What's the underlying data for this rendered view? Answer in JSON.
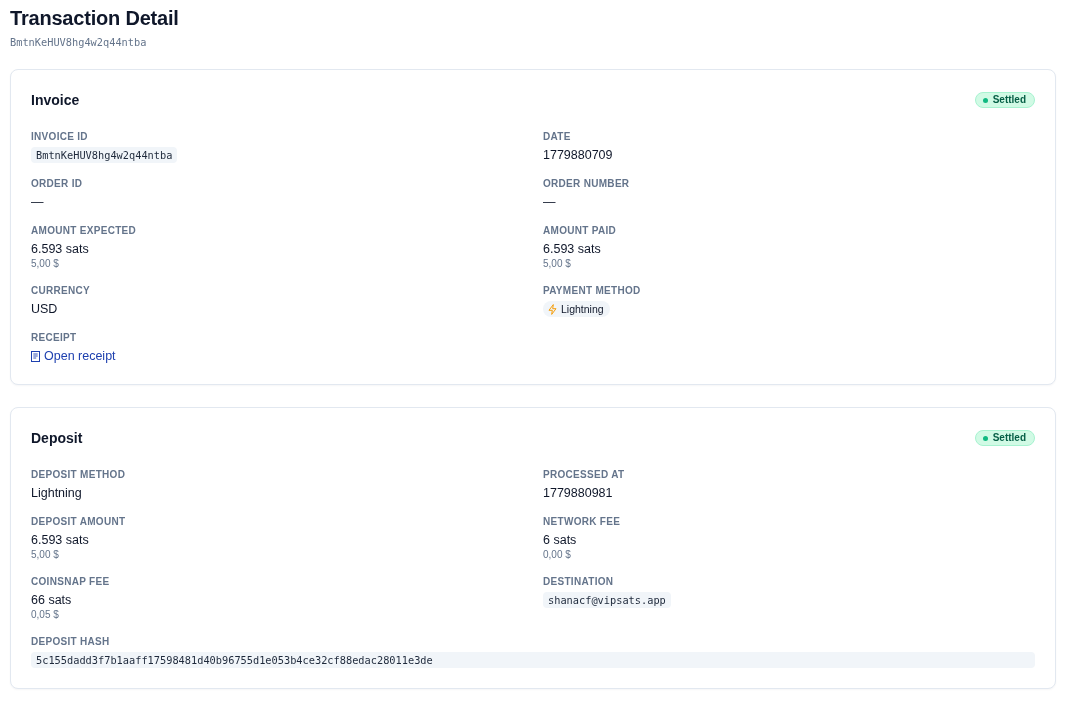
{
  "page": {
    "title": "Transaction Detail",
    "subtitle": "BmtnKeHUV8hg4w2q44ntba"
  },
  "sections": [
    {
      "title": "Invoice",
      "status": {
        "label": "Settled"
      },
      "fields": [
        {
          "label": "INVOICE ID",
          "kind": "code",
          "value": "BmtnKeHUV8hg4w2q44ntba"
        },
        {
          "label": "DATE",
          "kind": "text",
          "value": "1779880709"
        },
        {
          "label": "ORDER ID",
          "kind": "text",
          "value": "—"
        },
        {
          "label": "ORDER NUMBER",
          "kind": "text",
          "value": "—"
        },
        {
          "label": "AMOUNT EXPECTED",
          "kind": "amount",
          "value": "6.593 sats",
          "fiat": "5,00 $"
        },
        {
          "label": "AMOUNT PAID",
          "kind": "amount",
          "value": "6.593 sats",
          "fiat": "5,00 $"
        },
        {
          "label": "CURRENCY",
          "kind": "text",
          "value": "USD"
        },
        {
          "label": "PAYMENT METHOD",
          "kind": "method",
          "value": "Lightning"
        },
        {
          "label": "RECEIPT",
          "kind": "link",
          "value": "Open receipt"
        }
      ]
    },
    {
      "title": "Deposit",
      "status": {
        "label": "Settled"
      },
      "fields": [
        {
          "label": "DEPOSIT METHOD",
          "kind": "text",
          "value": "Lightning"
        },
        {
          "label": "PROCESSED AT",
          "kind": "text",
          "value": "1779880981"
        },
        {
          "label": "DEPOSIT AMOUNT",
          "kind": "amount",
          "value": "6.593 sats",
          "fiat": "5,00 $"
        },
        {
          "label": "NETWORK FEE",
          "kind": "amount",
          "value": "6 sats",
          "fiat": "0,00 $"
        },
        {
          "label": "COINSNAP FEE",
          "kind": "amount",
          "value": "66 sats",
          "fiat": "0,05 $"
        },
        {
          "label": "DESTINATION",
          "kind": "code",
          "value": "shanacf@vipsats.app"
        },
        {
          "label": "DEPOSIT HASH",
          "kind": "code-block",
          "value": "5c155dadd3f7b1aaff17598481d40b96755d1e053b4ce32cf88edac28011e3de"
        }
      ]
    }
  ]
}
